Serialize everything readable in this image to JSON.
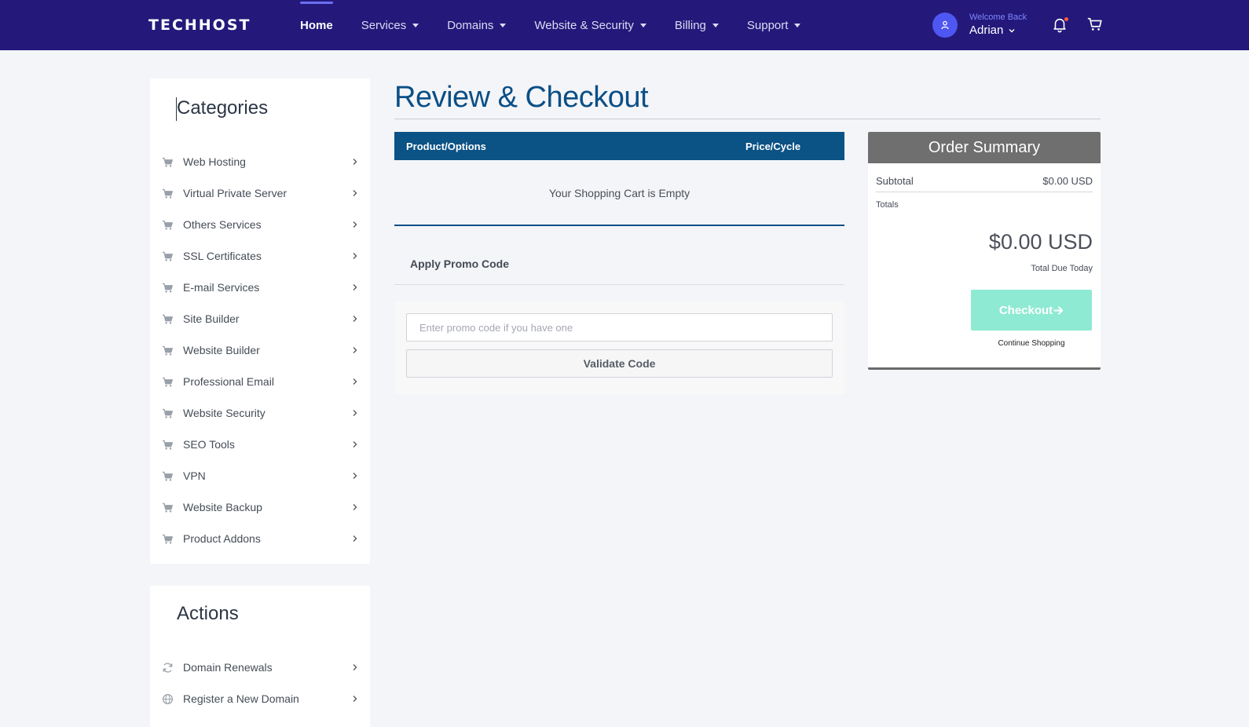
{
  "brand": {
    "logo_text": "TECHHOST"
  },
  "nav": {
    "items": [
      {
        "label": "Home"
      },
      {
        "label": "Services"
      },
      {
        "label": "Domains"
      },
      {
        "label": "Website & Security"
      },
      {
        "label": "Billing"
      },
      {
        "label": "Support"
      }
    ],
    "active": "Home"
  },
  "user": {
    "welcome": "Welcome Back",
    "name": "Adrian"
  },
  "notifications": {
    "has_unread": true
  },
  "sidebar": {
    "categories_title": "Categories",
    "categories": [
      {
        "label": "Web Hosting",
        "icon": "cart-icon"
      },
      {
        "label": "Virtual Private Server",
        "icon": "cart-icon"
      },
      {
        "label": "Others Services",
        "icon": "cart-icon"
      },
      {
        "label": "SSL Certificates",
        "icon": "cart-icon"
      },
      {
        "label": "E-mail Services",
        "icon": "cart-icon"
      },
      {
        "label": "Site Builder",
        "icon": "cart-icon"
      },
      {
        "label": "Website Builder",
        "icon": "cart-icon"
      },
      {
        "label": "Professional Email",
        "icon": "cart-icon"
      },
      {
        "label": "Website Security",
        "icon": "cart-icon"
      },
      {
        "label": "SEO Tools",
        "icon": "cart-icon"
      },
      {
        "label": "VPN",
        "icon": "cart-icon"
      },
      {
        "label": "Website Backup",
        "icon": "cart-icon"
      },
      {
        "label": "Product Addons",
        "icon": "cart-icon"
      }
    ],
    "actions_title": "Actions",
    "actions": [
      {
        "label": "Domain Renewals",
        "icon": "refresh-icon"
      },
      {
        "label": "Register a New Domain",
        "icon": "globe-icon"
      }
    ]
  },
  "main": {
    "title": "Review & Checkout",
    "cart": {
      "col_product": "Product/Options",
      "col_price": "Price/Cycle",
      "empty_message": "Your Shopping Cart is Empty"
    },
    "promo": {
      "title": "Apply Promo Code",
      "placeholder": "Enter promo code if you have one",
      "value": "",
      "button": "Validate Code"
    }
  },
  "summary": {
    "title": "Order Summary",
    "subtotal_label": "Subtotal",
    "subtotal_value": "$0.00 USD",
    "totals_label": "Totals",
    "total_amount": "$0.00 USD",
    "total_due_label": "Total Due Today",
    "checkout_label": "Checkout",
    "continue_label": "Continue Shopping"
  },
  "colors": {
    "navbar": "#24197a",
    "accent": "#0b4f86",
    "avatar": "#4f57f2",
    "checkout": "#8eead3",
    "summary_header": "#6f6f6f"
  }
}
